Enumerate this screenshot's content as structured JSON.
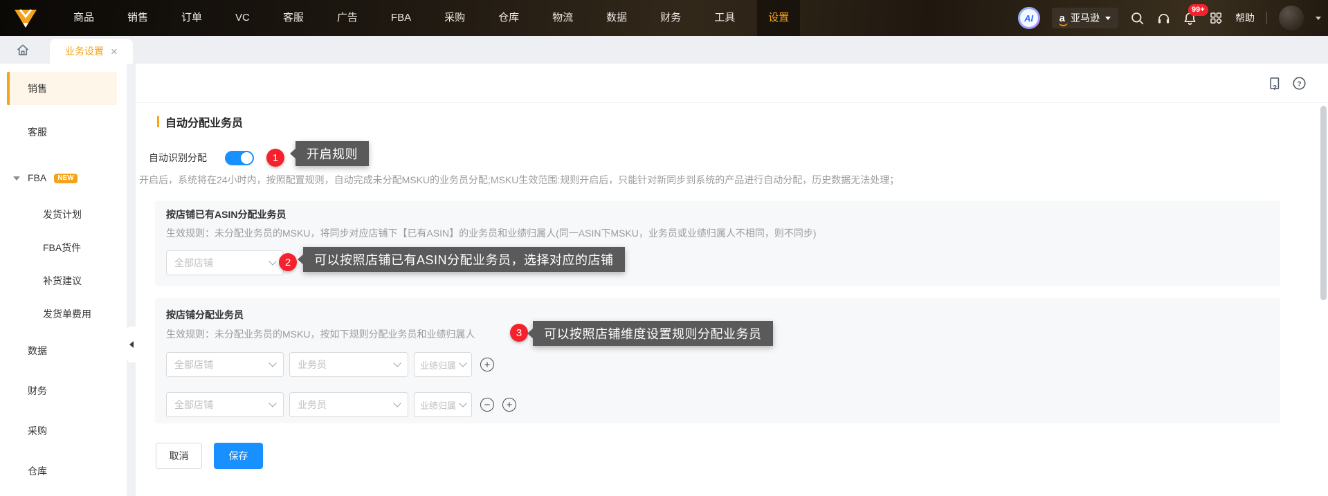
{
  "topnav": {
    "items": [
      "商品",
      "销售",
      "订单",
      "VC",
      "客服",
      "广告",
      "FBA",
      "采购",
      "仓库",
      "物流",
      "数据",
      "财务",
      "工具",
      "设置"
    ],
    "active_item": "设置",
    "ai_badge": "AI",
    "marketplace": {
      "logo_letter": "a",
      "label": "亚马逊"
    },
    "notification_count": "99+",
    "help_label": "帮助"
  },
  "tabbar": {
    "active_tab": "业务设置",
    "close_glyph": "×"
  },
  "sidebar": {
    "items": [
      {
        "label": "销售",
        "active": true
      },
      {
        "label": "客服"
      },
      {
        "label": "FBA",
        "badge": "NEW",
        "expanded": true
      },
      {
        "label": "发货计划",
        "sub": true
      },
      {
        "label": "FBA货件",
        "sub": true
      },
      {
        "label": "补货建议",
        "sub": true
      },
      {
        "label": "发货单费用",
        "sub": true
      },
      {
        "label": "数据"
      },
      {
        "label": "财务"
      },
      {
        "label": "采购"
      },
      {
        "label": "仓库"
      }
    ]
  },
  "content": {
    "title": "自动分配业务员",
    "auto_assign": {
      "label": "自动识别分配",
      "enabled": true,
      "step_num": "1",
      "tooltip": "开启规则",
      "description": "开启后，系统将在24小时内，按照配置规则，自动完成未分配MSKU的业务员分配;MSKU生效范围:规则开启后，只能针对新同步到系统的产品进行自动分配，历史数据无法处理；"
    },
    "panel_asin": {
      "heading": "按店铺已有ASIN分配业务员",
      "rule": "生效规则：未分配业务员的MSKU，将同步对应店铺下【已有ASIN】的业务员和业绩归属人(同一ASIN下MSKU，业务员或业绩归属人不相同，则不同步)",
      "shop_placeholder": "全部店铺",
      "step_num": "2",
      "tooltip": "可以按照店铺已有ASIN分配业务员，选择对应的店铺"
    },
    "panel_shop": {
      "heading": "按店铺分配业务员",
      "rule": "生效规则：未分配业务员的MSKU，按如下规则分配业务员和业绩归属人",
      "step_num": "3",
      "tooltip": "可以按照店铺维度设置规则分配业务员",
      "rows": [
        {
          "shop": "全部店铺",
          "salesman": "业务员",
          "owner": "业绩归属"
        },
        {
          "shop": "全部店铺",
          "salesman": "业务员",
          "owner": "业绩归属"
        }
      ],
      "add_icon_glyph": "+",
      "remove_icon_glyph": "−"
    },
    "cancel_label": "取消",
    "save_label": "保存"
  },
  "colors": {
    "accent_orange": "#F5A31B",
    "primary_blue": "#1890FF",
    "badge_red": "#F5222D",
    "tooltip_bg": "#5A5A5A",
    "nav_bg": "#221A10",
    "panel_bg": "#F7F8FA"
  }
}
